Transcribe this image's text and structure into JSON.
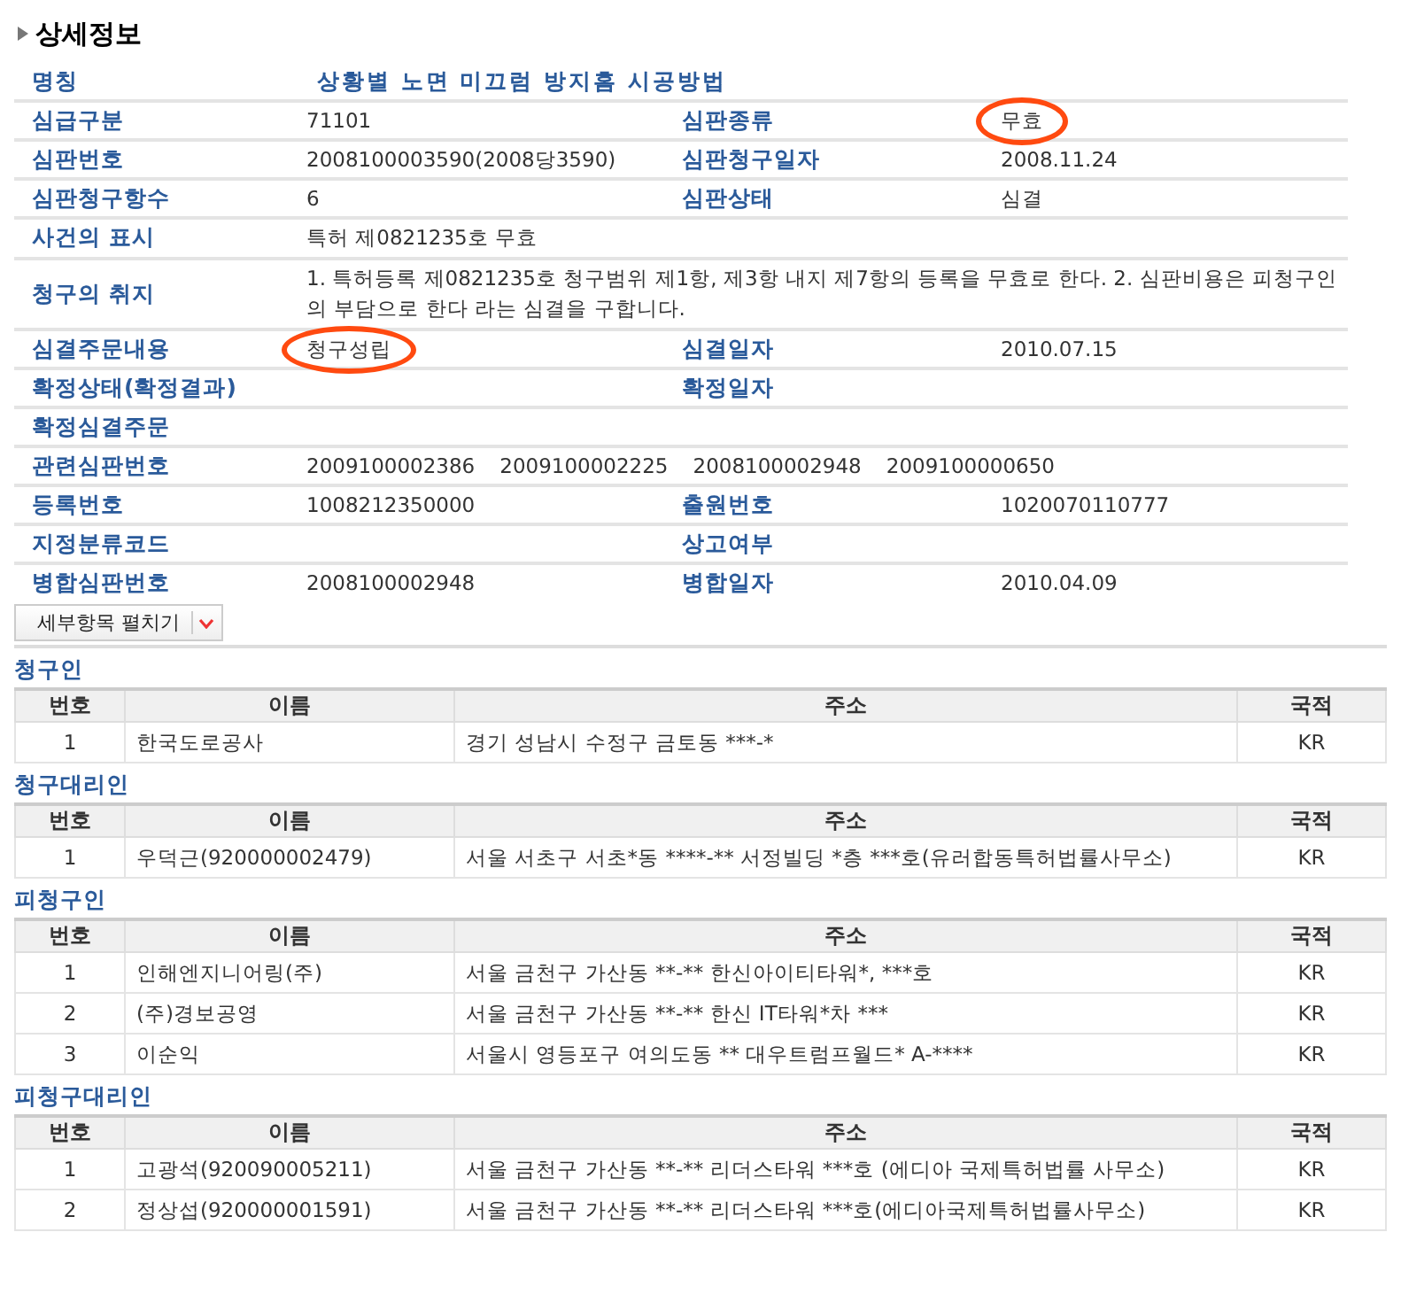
{
  "title": "상세정보",
  "detail_rows": [
    {
      "kind": "heading",
      "fields": [
        {
          "label": "명칭",
          "value": "상황별 노면 미끄럼 방지홈 시공방법"
        }
      ]
    },
    {
      "kind": "pair",
      "fields": [
        {
          "label": "심급구분",
          "value": "71101",
          "circled": false
        },
        {
          "label": "심판종류",
          "value": "무효",
          "circled": true
        }
      ]
    },
    {
      "kind": "pair",
      "fields": [
        {
          "label": "심판번호",
          "value": "2008100003590(2008당3590)",
          "circled": false
        },
        {
          "label": "심판청구일자",
          "value": "2008.11.24",
          "circled": false
        }
      ]
    },
    {
      "kind": "pair",
      "fields": [
        {
          "label": "심판청구항수",
          "value": "6",
          "circled": false
        },
        {
          "label": "심판상태",
          "value": "심결",
          "circled": false
        }
      ]
    },
    {
      "kind": "wide",
      "fields": [
        {
          "label": "사건의 표시",
          "value": "특허 제0821235호 무효"
        }
      ]
    },
    {
      "kind": "wide",
      "fields": [
        {
          "label": "청구의 취지",
          "value": "1. 특허등록 제0821235호 청구범위 제1항, 제3항 내지 제7항의 등록을 무효로 한다. 2. 심판비용은 피청구인의 부담으로 한다 라는 심결을 구합니다."
        }
      ]
    },
    {
      "kind": "pair",
      "fields": [
        {
          "label": "심결주문내용",
          "value": "청구성립",
          "circled": true
        },
        {
          "label": "심결일자",
          "value": "2010.07.15",
          "circled": false
        }
      ]
    },
    {
      "kind": "pair",
      "fields": [
        {
          "label": "확정상태(확정결과)"
        },
        {
          "label": "확정일자"
        }
      ]
    },
    {
      "kind": "wide",
      "fields": [
        {
          "label": "확정심결주문"
        }
      ]
    },
    {
      "kind": "list",
      "fields": [
        {
          "label": "관련심판번호",
          "values": [
            "2009100002386",
            "2009100002225",
            "2008100002948",
            "2009100000650"
          ]
        }
      ]
    },
    {
      "kind": "pair",
      "fields": [
        {
          "label": "등록번호",
          "value": "1008212350000",
          "circled": false
        },
        {
          "label": "출원번호",
          "value": "1020070110777",
          "circled": false
        }
      ]
    },
    {
      "kind": "pair",
      "fields": [
        {
          "label": "지정분류코드"
        },
        {
          "label": "상고여부"
        }
      ]
    },
    {
      "kind": "pair",
      "fields": [
        {
          "label": "병합심판번호",
          "value": "2008100002948",
          "circled": false
        },
        {
          "label": "병합일자",
          "value": "2010.04.09",
          "circled": false
        }
      ]
    }
  ],
  "expand_button": {
    "label": "세부항목 펼치기"
  },
  "sections": [
    {
      "title": "청구인",
      "columns": [
        "번호",
        "이름",
        "주소",
        "국적"
      ],
      "rows": [
        [
          "1",
          "한국도로공사",
          "경기 성남시 수정구 금토동 ***-*",
          "KR"
        ]
      ]
    },
    {
      "title": "청구대리인",
      "columns": [
        "번호",
        "이름",
        "주소",
        "국적"
      ],
      "rows": [
        [
          "1",
          "우덕근(920000002479)",
          "서울 서초구 서초*동 ****-** 서정빌딩 *층 ***호(유러합동특허법률사무소)",
          "KR"
        ]
      ]
    },
    {
      "title": "피청구인",
      "columns": [
        "번호",
        "이름",
        "주소",
        "국적"
      ],
      "rows": [
        [
          "1",
          "인해엔지니어링(주)",
          "서울 금천구 가산동 **-** 한신아이티타워*, ***호",
          "KR"
        ],
        [
          "2",
          "(주)경보공영",
          "서울 금천구 가산동 **-** 한신 IT타워*차 ***",
          "KR"
        ],
        [
          "3",
          "이순익",
          "서울시 영등포구 여의도동 ** 대우트럼프월드* A-****",
          "KR"
        ]
      ]
    },
    {
      "title": "피청구대리인",
      "columns": [
        "번호",
        "이름",
        "주소",
        "국적"
      ],
      "rows": [
        [
          "1",
          "고광석(920090005211)",
          "서울 금천구 가산동 **-** 리더스타워 ***호 (에디아 국제특허법률 사무소)",
          "KR"
        ],
        [
          "2",
          "정상섭(920000001591)",
          "서울 금천구 가산동 **-** 리더스타워 ***호(에디아국제특허법률사무소)",
          "KR"
        ]
      ]
    }
  ]
}
